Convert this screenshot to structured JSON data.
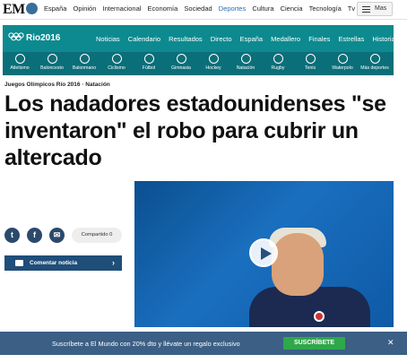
{
  "topnav": {
    "logo": "EM",
    "links": [
      "España",
      "Opinión",
      "Internacional",
      "Economía",
      "Sociedad",
      "Deportes",
      "Cultura",
      "Ciencia",
      "Tecnología",
      "Tv"
    ],
    "active_link": "Deportes",
    "more_label": "Mas"
  },
  "rio": {
    "logo_text": "Rio2016",
    "nav": [
      "Noticias",
      "Calendario",
      "Resultados",
      "Directo",
      "España",
      "Medallero",
      "Finales",
      "Estrellas",
      "Historia"
    ],
    "sports": [
      "Atletismo",
      "Baloncesto",
      "Balonmano",
      "Ciclismo",
      "Fútbol",
      "Gimnasia",
      "Hockey",
      "Natación",
      "Rugby",
      "Tenis",
      "Waterpolo",
      "Más deportes"
    ]
  },
  "breadcrumb": "Juegos Olímpicos Río 2016 · Natación",
  "headline": "Los nadadores estadounidenses \"se inventaron\" el robo para cubrir un altercado",
  "share": {
    "twitter": "t",
    "facebook": "f",
    "email": "✉",
    "shared_label": "Compartido 0",
    "comment_label": "Comentar noticia",
    "comment_chevron": "›"
  },
  "subscribe": {
    "text": "Suscríbete a El Mundo con 20% dto y llévate un regalo exclusivo",
    "button": "SUSCRÍBETE",
    "close": "✕"
  },
  "colors": {
    "rio_teal": "#0d8a8f",
    "brand_blue": "#1f4e79",
    "subscribe_green": "#2ea84a"
  }
}
